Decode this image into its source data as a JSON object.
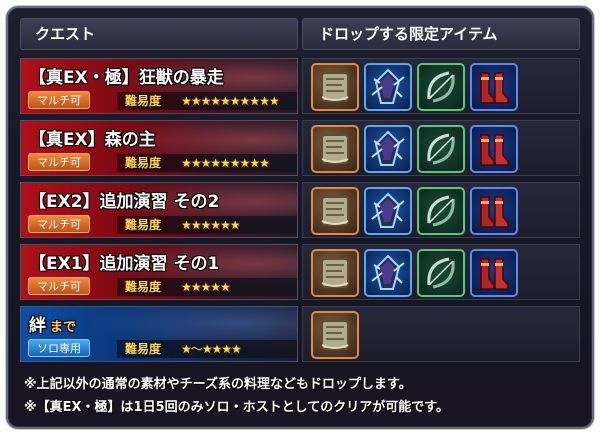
{
  "headers": {
    "quest": "クエスト",
    "drops": "ドロップする限定アイテム"
  },
  "difficulty_label": "難易度",
  "quests": [
    {
      "name": "【真EX・極】狂獣の暴走",
      "suffix": "",
      "badge": "マルチ可",
      "badge_type": "multi",
      "stars": "★★★★★★★★★★",
      "theme": "red",
      "items": [
        "scroll-icon",
        "crystal-icon",
        "bow-icon",
        "boots-icon"
      ]
    },
    {
      "name": "【真EX】森の主",
      "suffix": "",
      "badge": "マルチ可",
      "badge_type": "multi",
      "stars": "★★★★★★★★★",
      "theme": "red",
      "items": [
        "scroll-icon",
        "crystal-icon",
        "bow-icon",
        "boots-icon"
      ]
    },
    {
      "name": "【EX2】追加演習 その2",
      "suffix": "",
      "badge": "マルチ可",
      "badge_type": "multi",
      "stars": "★★★★★★",
      "theme": "red",
      "items": [
        "scroll-icon",
        "crystal-icon",
        "bow-icon",
        "boots-icon"
      ]
    },
    {
      "name": "【EX1】追加演習 その1",
      "suffix": "",
      "badge": "マルチ可",
      "badge_type": "multi",
      "stars": "★★★★★",
      "theme": "red",
      "items": [
        "scroll-icon",
        "crystal-icon",
        "bow-icon",
        "boots-icon"
      ]
    },
    {
      "name": "絆",
      "suffix": "まで",
      "badge": "ソロ専用",
      "badge_type": "solo",
      "stars": "★～★★★★",
      "theme": "blue",
      "items": [
        "scroll-icon"
      ]
    }
  ],
  "notes": [
    "※上記以外の通常の素材やチーズ系の料理などもドロップします。",
    "※【真EX・極】は1日5回のみソロ・ホストとしてのクリアが可能です。"
  ],
  "colors": {
    "quest_red": "#b10f18",
    "quest_blue": "#0d4ea8",
    "star_gold": "#ffd84a",
    "badge_multi": "#e0702a",
    "badge_solo": "#2a86d8"
  }
}
